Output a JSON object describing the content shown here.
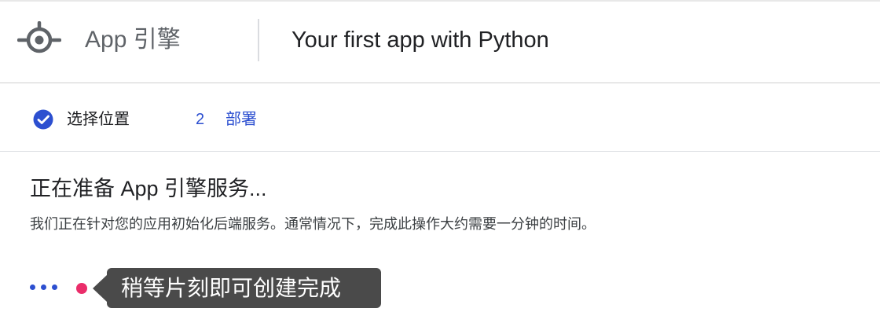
{
  "header": {
    "logo_icon": "app-engine-logo-icon",
    "product_name": "App 引擎",
    "page_title": "Your first app with Python"
  },
  "stepper": {
    "steps": [
      {
        "label": "选择位置",
        "status": "completed",
        "icon": "check-circle-icon"
      },
      {
        "number": "2",
        "label": "部署",
        "status": "active"
      }
    ]
  },
  "content": {
    "title": "正在准备 App 引擎服务...",
    "description": "我们正在针对您的应用初始化后端服务。通常情况下，完成此操作大约需要一分钟的时间。",
    "progress_icon": "loading-dots-icon"
  },
  "tooltip": {
    "text": "稍等片刻即可创建完成"
  },
  "colors": {
    "accent_blue": "#2c4fd0",
    "tooltip_bg": "#4a4a4a",
    "highlight_pink": "#ea2d6a"
  }
}
